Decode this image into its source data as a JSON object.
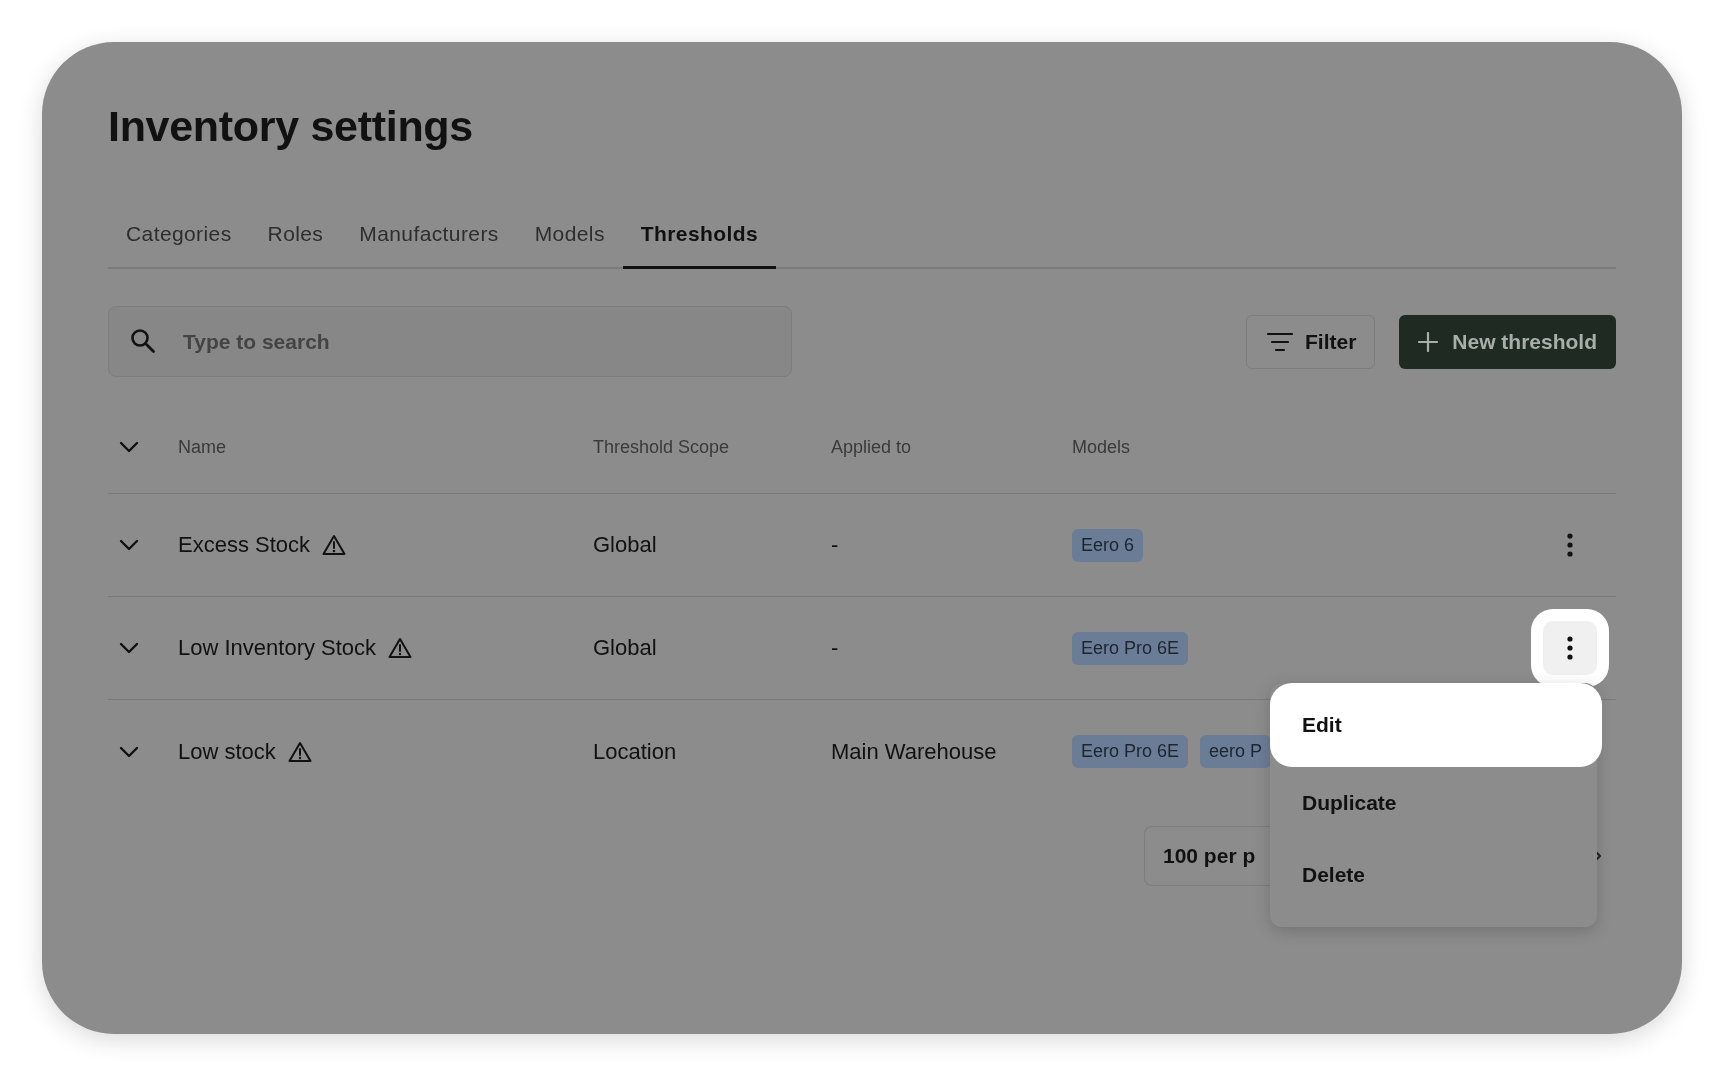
{
  "page": {
    "title": "Inventory settings"
  },
  "tabs": [
    {
      "label": "Categories",
      "selected": false
    },
    {
      "label": "Roles",
      "selected": false
    },
    {
      "label": "Manufacturers",
      "selected": false
    },
    {
      "label": "Models",
      "selected": false
    },
    {
      "label": "Thresholds",
      "selected": true
    }
  ],
  "search": {
    "placeholder": "Type to search"
  },
  "toolbar": {
    "filter": "Filter",
    "new_button": "New threshold"
  },
  "table": {
    "columns": [
      "Name",
      "Threshold Scope",
      "Applied to",
      "Models"
    ],
    "rows": [
      {
        "name": "Excess Stock",
        "warning": true,
        "scope": "Global",
        "applied_to": "-",
        "models": [
          "Eero 6"
        ],
        "menu_open": false
      },
      {
        "name": "Low Inventory Stock",
        "warning": true,
        "scope": "Global",
        "applied_to": "-",
        "models": [
          "Eero Pro 6E"
        ],
        "menu_open": true
      },
      {
        "name": "Low stock",
        "warning": true,
        "scope": "Location",
        "applied_to": "Main Warehouse",
        "models": [
          "Eero Pro 6E",
          "eero P"
        ],
        "menu_open": false
      }
    ]
  },
  "row_menu": {
    "items": [
      {
        "label": "Edit",
        "highlighted": true
      },
      {
        "label": "Duplicate",
        "highlighted": false
      },
      {
        "label": "Delete",
        "highlighted": false
      }
    ]
  },
  "pagination": {
    "page_size": "100 per p"
  }
}
